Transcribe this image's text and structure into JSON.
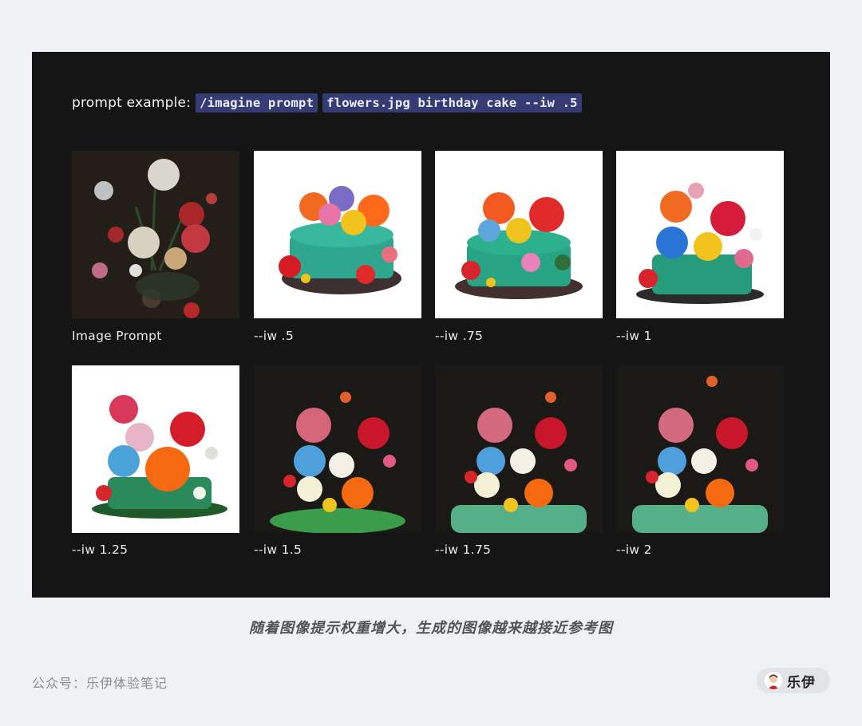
{
  "prompt": {
    "label": "prompt example:",
    "command": "/imagine prompt",
    "args": "flowers.jpg birthday cake --iw .5"
  },
  "gallery": [
    {
      "caption": "Image Prompt",
      "kind": "painting"
    },
    {
      "caption": "--iw .5",
      "kind": "cake-white"
    },
    {
      "caption": "--iw .75",
      "kind": "cake-white"
    },
    {
      "caption": "--iw 1",
      "kind": "cake-white"
    },
    {
      "caption": "--iw 1.25",
      "kind": "cake-white"
    },
    {
      "caption": "--iw 1.5",
      "kind": "cake-dark"
    },
    {
      "caption": "--iw 1.75",
      "kind": "cake-dark"
    },
    {
      "caption": "--iw 2",
      "kind": "cake-dark"
    }
  ],
  "figure_caption": "随着图像提示权重增大，生成的图像越来越接近参考图",
  "footer": {
    "account": "公众号：乐伊体验笔记",
    "author": "乐伊"
  },
  "colors": {
    "panel": "#151515",
    "code_bg": "#343c73",
    "page_bg": "#eff1f4"
  }
}
